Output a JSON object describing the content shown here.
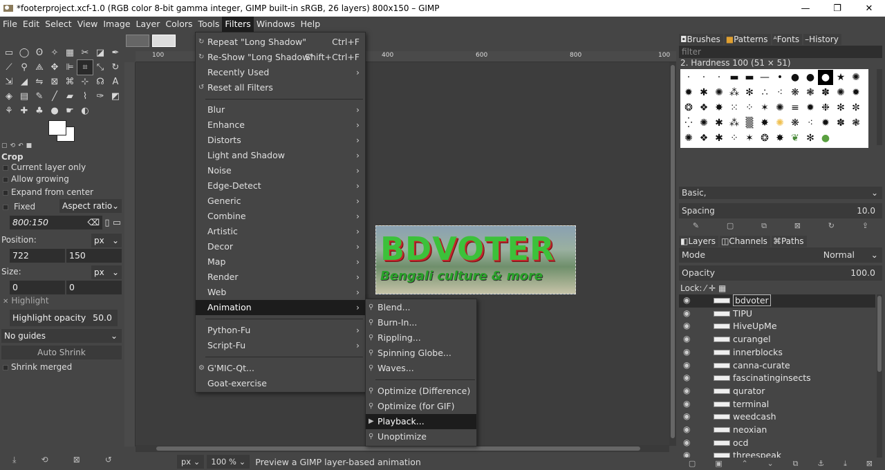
{
  "window": {
    "title": "*footerproject.xcf-1.0 (RGB color 8-bit gamma integer, GIMP built-in sRGB, 26 layers) 800x150 – GIMP",
    "minimize": "—",
    "maximize": "❐",
    "close": "✕"
  },
  "menubar": [
    "File",
    "Edit",
    "Select",
    "View",
    "Image",
    "Layer",
    "Colors",
    "Tools",
    "Filters",
    "Windows",
    "Help"
  ],
  "filters_menu": {
    "repeat": {
      "label": "Repeat \"Long Shadow\"",
      "accel": "Ctrl+F"
    },
    "reshow": {
      "label": "Re-Show \"Long Shadow\"",
      "accel": "Shift+Ctrl+F"
    },
    "recently_used": "Recently Used",
    "reset": "Reset all Filters",
    "blur": "Blur",
    "enhance": "Enhance",
    "distorts": "Distorts",
    "light_shadow": "Light and Shadow",
    "noise": "Noise",
    "edge_detect": "Edge-Detect",
    "generic": "Generic",
    "combine": "Combine",
    "artistic": "Artistic",
    "decor": "Decor",
    "map": "Map",
    "render": "Render",
    "web": "Web",
    "animation": "Animation",
    "python_fu": "Python-Fu",
    "script_fu": "Script-Fu",
    "gmic": "G'MIC-Qt...",
    "goat": "Goat-exercise"
  },
  "animation_menu": {
    "blend": "Blend...",
    "burn_in": "Burn-In...",
    "rippling": "Rippling...",
    "spinning_globe": "Spinning Globe...",
    "waves": "Waves...",
    "opt_diff": "Optimize (Difference)",
    "opt_gif": "Optimize (for GIF)",
    "playback": "Playback...",
    "unoptimize": "Unoptimize"
  },
  "tool_options": {
    "tool_name": "Crop",
    "current_layer_only": "Current layer only",
    "allow_growing": "Allow growing",
    "expand_from_center": "Expand from center",
    "fixed": "Fixed",
    "aspect_ratio": "Aspect ratio",
    "ratio_value": "800:150",
    "position_label": "Position:",
    "position_unit": "px",
    "pos_x": "722",
    "pos_y": "150",
    "size_label": "Size:",
    "size_unit": "px",
    "size_w": "0",
    "size_h": "0",
    "highlight": "Highlight",
    "highlight_opacity_label": "Highlight opacity",
    "highlight_opacity_value": "50.0",
    "guides": "No guides",
    "auto_shrink": "Auto Shrink",
    "shrink_merged": "Shrink merged"
  },
  "canvas": {
    "ruler_marks": [
      "100",
      "400",
      "600",
      "800",
      "100"
    ],
    "logo_text": "BDVOTER",
    "tagline": "Bengali culture & more"
  },
  "statusbar": {
    "unit": "px",
    "zoom": "100 %",
    "message": "Preview a GIMP layer-based animation"
  },
  "dock_top": {
    "tabs": [
      "Brushes",
      "Patterns",
      "Fonts",
      "History"
    ],
    "filter_placeholder": "filter",
    "brush_name": "2. Hardness 100 (51 × 51)",
    "preset": "Basic,",
    "spacing_label": "Spacing",
    "spacing_value": "10.0"
  },
  "dock_bottom": {
    "tabs": [
      "Layers",
      "Channels",
      "Paths"
    ],
    "mode_label": "Mode",
    "mode_value": "Normal",
    "opacity_label": "Opacity",
    "opacity_value": "100.0",
    "lock_label": "Lock:",
    "layers": [
      "bdvoter",
      "TIPU",
      "HiveUpMe",
      "curangel",
      "innerblocks",
      "canna-curate",
      "fascinatinginsects",
      "qurator",
      "terminal",
      "weedcash",
      "neoxian",
      "ocd",
      "threespeak"
    ]
  }
}
